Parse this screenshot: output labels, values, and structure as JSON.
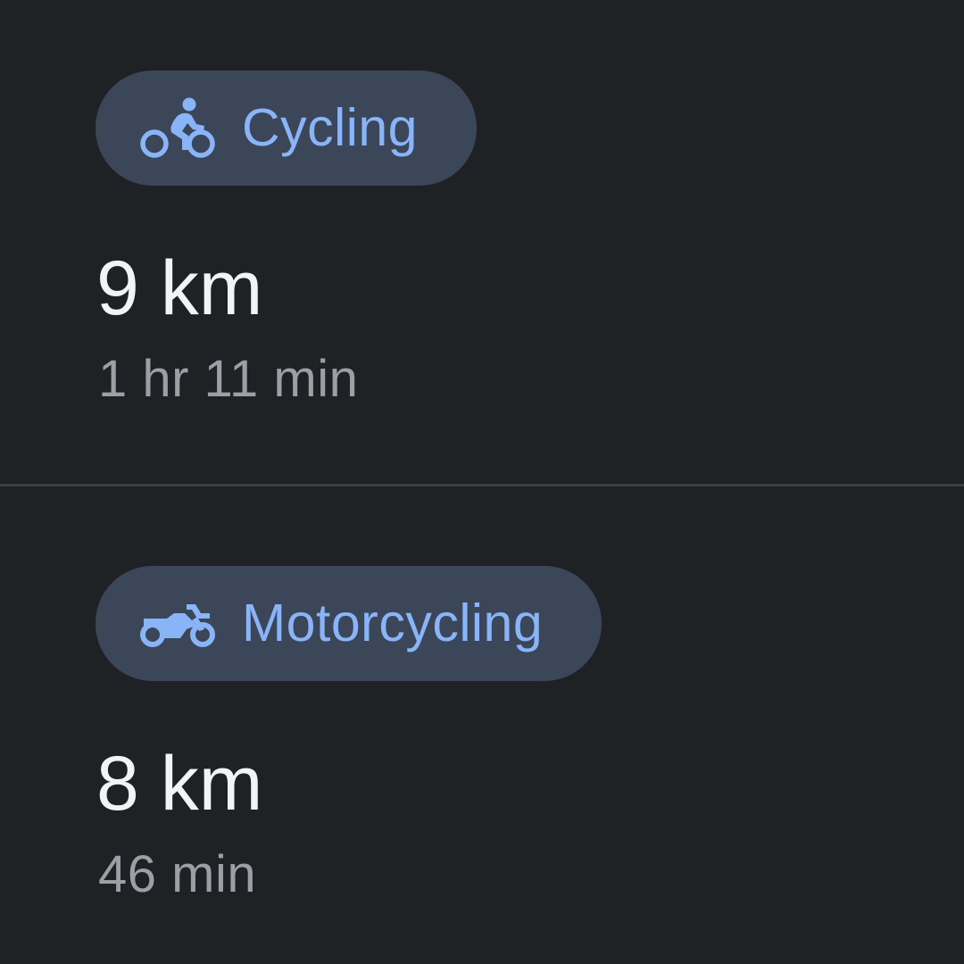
{
  "colors": {
    "background": "#202125",
    "chip_background": "#3c4659",
    "accent": "#8ab4f8",
    "primary_text": "#f1f3f4",
    "secondary_text": "#9aa0a6",
    "divider": "#3c4043"
  },
  "routes": [
    {
      "mode_label": "Cycling",
      "icon": "bicycle-icon",
      "distance": "9 km",
      "duration": "1 hr 11 min"
    },
    {
      "mode_label": "Motorcycling",
      "icon": "motorcycle-icon",
      "distance": "8 km",
      "duration": "46 min"
    }
  ]
}
